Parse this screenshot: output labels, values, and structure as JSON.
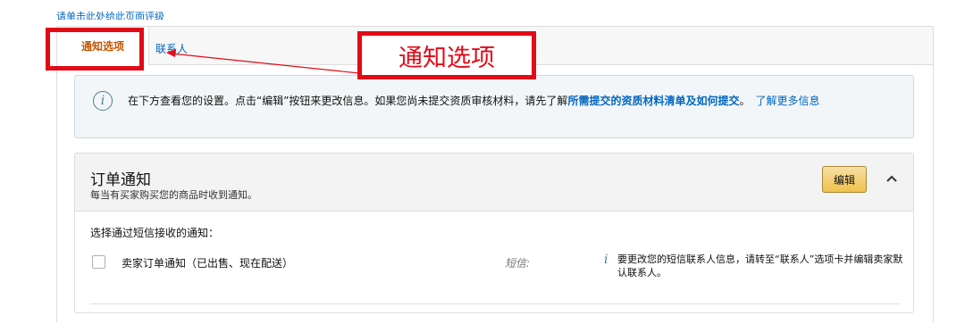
{
  "top_link": "请单击此处给此页面评级",
  "tabs": {
    "active": "通知选项",
    "contacts": "联系人"
  },
  "annotation": {
    "label": "通知选项",
    "color": "#e30a17"
  },
  "info": {
    "text_prefix": "在下方查看您的设置。点击“编辑”按钮来更改信息。如果您尚未提交资质审核材料，请先了解",
    "link_bold": "所需提交的资质材料清单及如何提交",
    "text_suffix": "。",
    "learn_more": "了解更多信息",
    "icon": "info-icon"
  },
  "order_section": {
    "title": "订单通知",
    "subtitle": "每当有买家购买您的商品时收到通知。",
    "edit_label": "编辑",
    "choose_label": "选择通过短信接收的通知：",
    "option_label": "卖家订单通知（已出售、现在配送）",
    "channel": "短信:",
    "note": "要更改您的短信联系人信息，请转至“联系人”选项卡并编辑卖家默认联系人。"
  },
  "colors": {
    "link": "#0066c0",
    "active_tab": "#c45500",
    "button": "#f0c14b"
  }
}
